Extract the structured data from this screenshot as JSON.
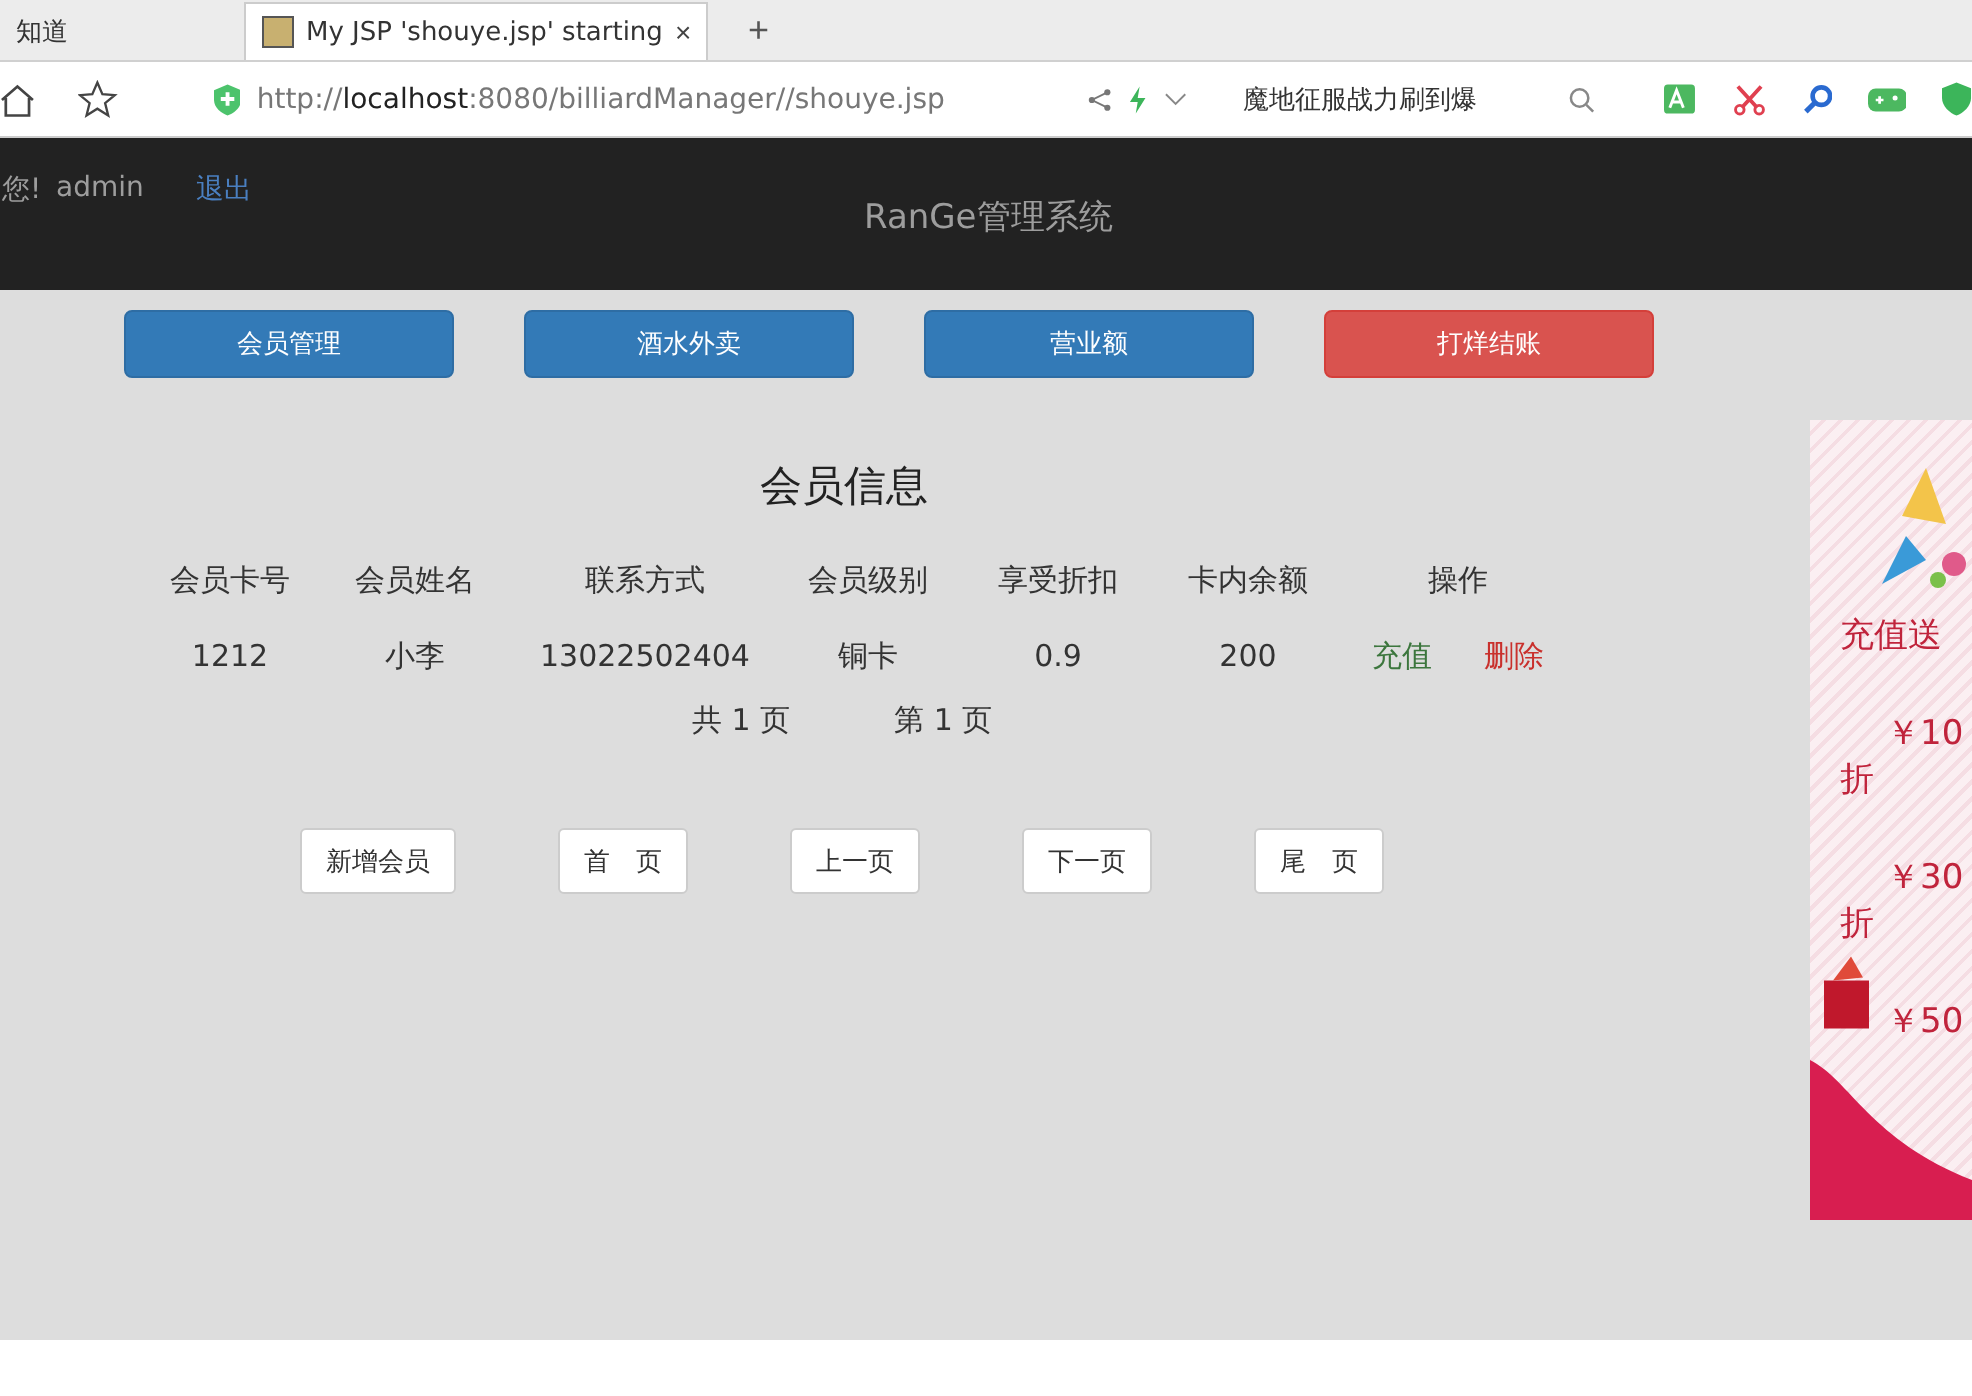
{
  "browser": {
    "tabs": [
      {
        "title": "知道",
        "selected": false
      },
      {
        "title": "My JSP 'shouye.jsp' starting",
        "selected": true
      }
    ],
    "close_glyph": "×",
    "new_tab_glyph": "+",
    "url_scheme": "http://",
    "url_host": "localhost",
    "url_rest": ":8080/billiardManager//shouye.jsp",
    "search_text": "魔地征服战力刷到爆"
  },
  "header": {
    "greeting": "您!",
    "user": "admin",
    "logout": "退出",
    "title": "RanGe管理系统"
  },
  "nav_buttons": [
    {
      "label": "会员管理",
      "kind": "primary"
    },
    {
      "label": "酒水外卖",
      "kind": "primary"
    },
    {
      "label": "营业额",
      "kind": "primary"
    },
    {
      "label": "打烊结账",
      "kind": "danger"
    }
  ],
  "table": {
    "title": "会员信息",
    "columns": [
      "会员卡号",
      "会员姓名",
      "联系方式",
      "会员级别",
      "享受折扣",
      "卡内余额",
      "操作"
    ],
    "rows": [
      {
        "cells": [
          "1212",
          "小李",
          "13022502404",
          "铜卡",
          "0.9",
          "200"
        ],
        "actions": [
          {
            "label": "充值",
            "kind": "recharge"
          },
          {
            "label": "删除",
            "kind": "delete"
          }
        ]
      }
    ],
    "total_pages": "共 1 页",
    "current_page": "第 1 页"
  },
  "pager_buttons": [
    "新增会员",
    "首　页",
    "上一页",
    "下一页",
    "尾　页"
  ],
  "ad_banner": {
    "title": "充值送",
    "lines": [
      "￥10",
      "折",
      "￥30",
      "折",
      "￥50"
    ]
  }
}
